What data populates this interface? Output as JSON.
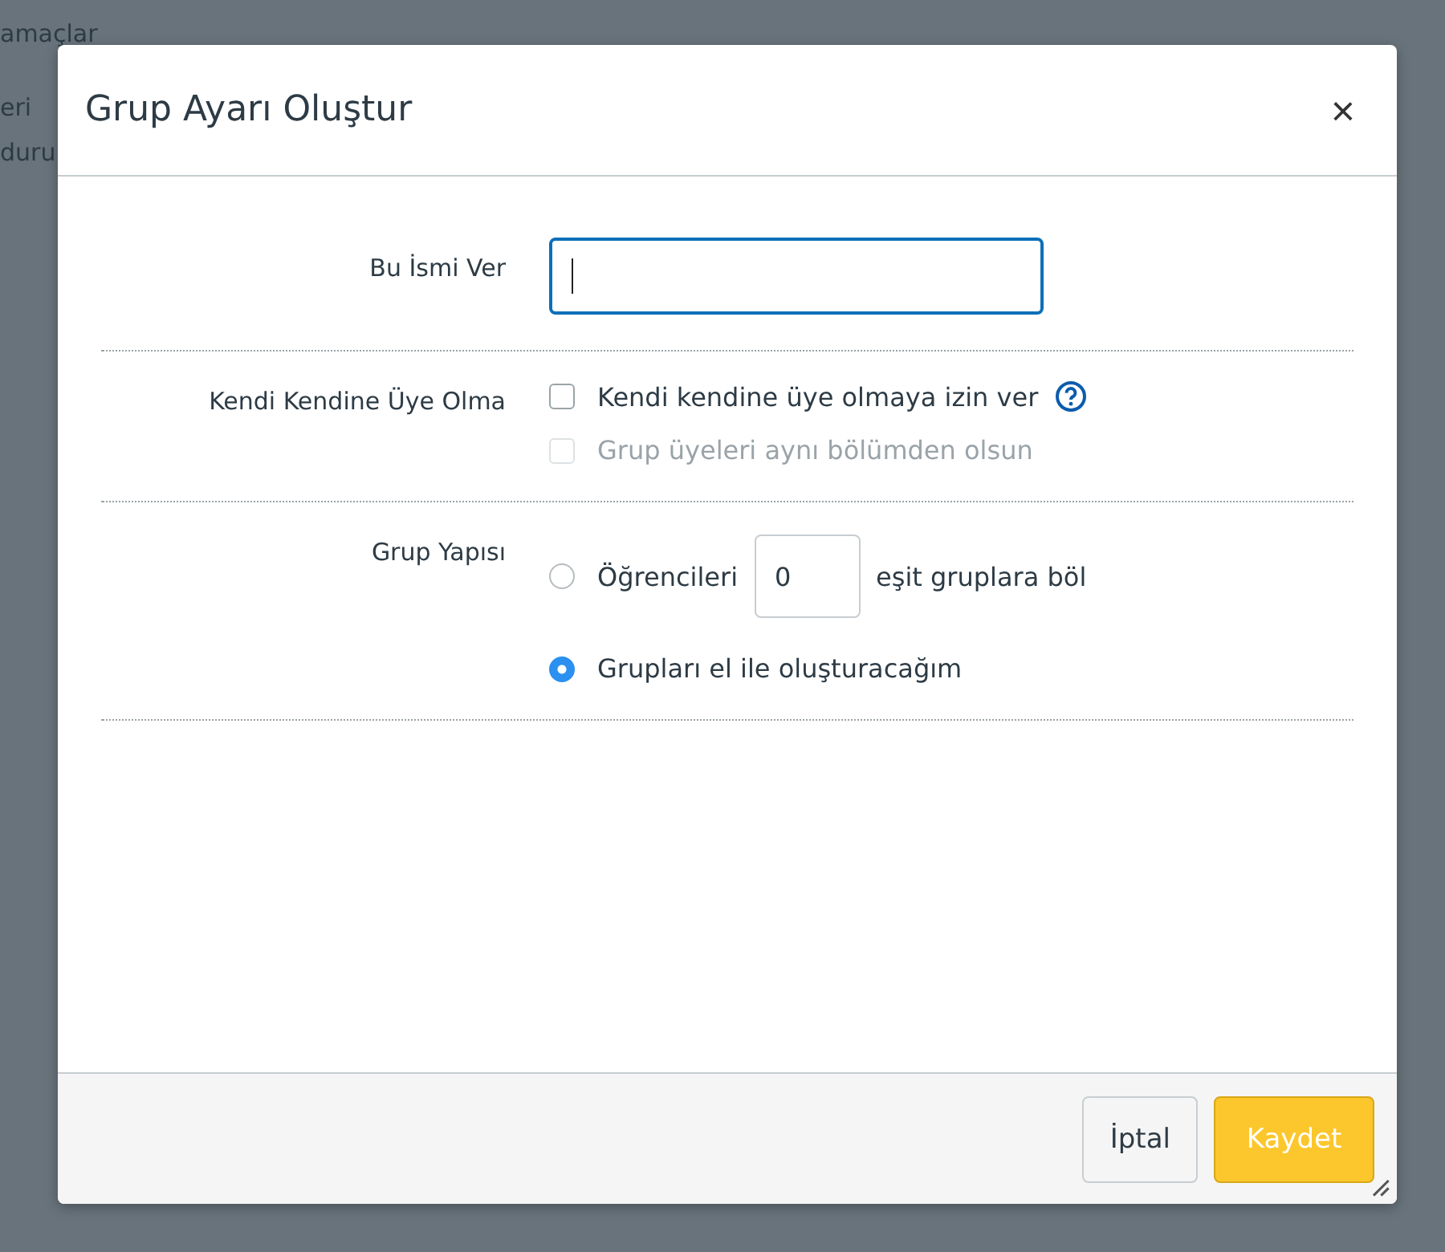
{
  "background": {
    "lines": [
      "amaçlar",
      "eri",
      "duru"
    ]
  },
  "dialog": {
    "title": "Grup Ayarı Oluştur",
    "close": "×",
    "name_row": {
      "label": "Bu İsmi Ver",
      "focused": true
    },
    "self_signup": {
      "label": "Kendi Kendine Üye Olma",
      "options": [
        {
          "label": "Kendi kendine üye olmaya izin ver",
          "checked": false,
          "disabled": false,
          "help": true
        },
        {
          "label": "Grup üyeleri aynı bölümden olsun",
          "checked": false,
          "disabled": true,
          "help": false
        }
      ]
    },
    "structure": {
      "label": "Grup Yapısı",
      "options": [
        {
          "kind": "split",
          "before": "Öğrencileri",
          "value": "0",
          "after": "eşit gruplara böl",
          "selected": false
        },
        {
          "kind": "manual",
          "label": "Grupları el ile oluşturacağım",
          "selected": true
        }
      ]
    },
    "buttons": [
      {
        "label": "İptal",
        "kind": "secondary"
      },
      {
        "label": "Kaydet",
        "kind": "primary"
      }
    ]
  }
}
